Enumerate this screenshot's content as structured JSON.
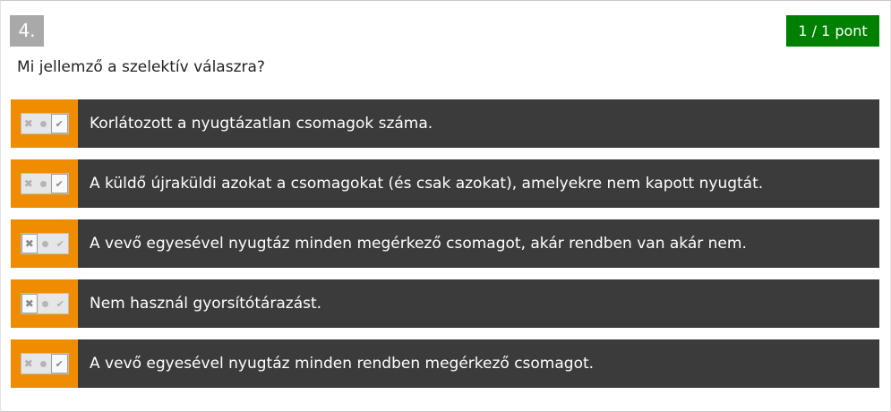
{
  "question": {
    "number": "4.",
    "score": "1 / 1 pont",
    "text": "Mi jellemző a szelektív válaszra?"
  },
  "icons": {
    "false": "x-icon",
    "neutral": "dot-icon",
    "true": "check-icon"
  },
  "colors": {
    "toggle_background": "#f08c00",
    "answer_background": "#3b3b3b",
    "score_badge": "#008000",
    "number_badge": "#a9a9a9"
  },
  "answers": [
    {
      "text": "Korlátozott a nyugtázatlan csomagok száma.",
      "selected": "true"
    },
    {
      "text": "A küldő újraküldi azokat a csomagokat (és csak azokat), amelyekre nem kapott nyugtát.",
      "selected": "true"
    },
    {
      "text": "A vevő egyesével nyugtáz minden megérkező csomagot, akár rendben van akár nem.",
      "selected": "false"
    },
    {
      "text": "Nem használ gyorsítótárazást.",
      "selected": "false"
    },
    {
      "text": "A vevő egyesével nyugtáz minden rendben megérkező csomagot.",
      "selected": "true"
    }
  ]
}
